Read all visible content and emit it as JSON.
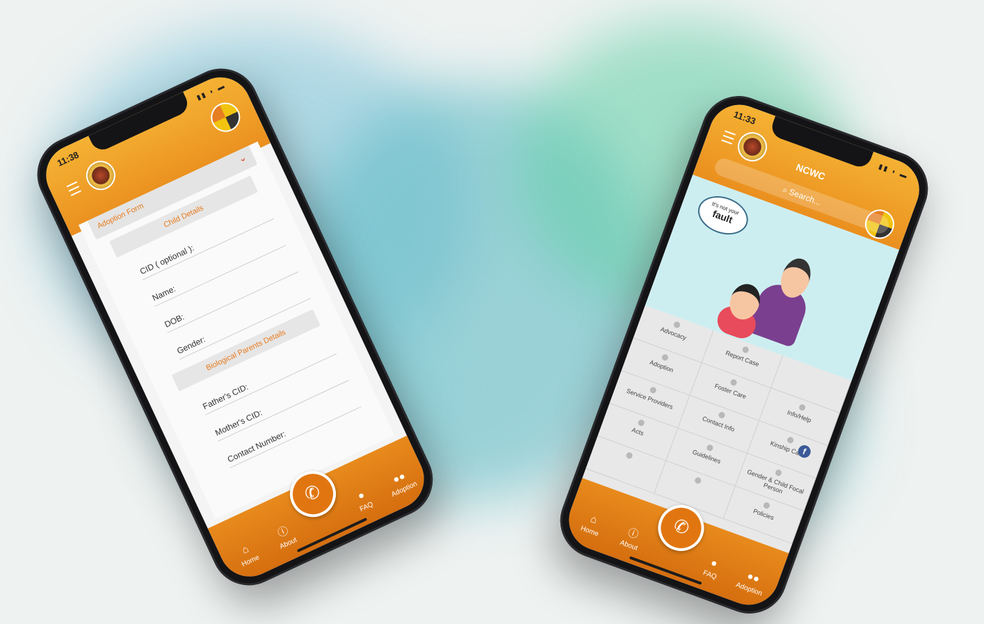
{
  "colors": {
    "accent": "#ea8f1f",
    "accent_dark": "#d56e0f",
    "label_orange": "#e77a1d",
    "background_teal": "#5fc2c6"
  },
  "left_phone": {
    "status_time": "11:38",
    "form_header": "Adoption Form",
    "sections": [
      "Child Details",
      "Biological Parents Details"
    ],
    "fields": [
      "CID ( optional ):",
      "Name:",
      "DOB:",
      "Gender:",
      "Father's CID:",
      "Mother's CID:",
      "Contact Number:"
    ]
  },
  "right_phone": {
    "status_time": "11:33",
    "app_title": "NCWC",
    "search_placeholder": "Search...",
    "hero_bubble_small": "It's not your",
    "hero_bubble_big": "fault",
    "grid_items": [
      "Advocacy",
      "Report Case",
      "",
      "Adoption",
      "Foster Care",
      "Info/Help",
      "Service Providers",
      "Contact Info",
      "Kinship Care",
      "Acts",
      "Guidelines",
      "Gender & Child Focal Person",
      "",
      "",
      "Policies"
    ]
  },
  "tabbar": {
    "tabs": [
      {
        "label": "Home",
        "icon": "home-icon"
      },
      {
        "label": "About",
        "icon": "info-icon"
      },
      {
        "label": "FAQ",
        "icon": "faq-icon"
      },
      {
        "label": "Adoption",
        "icon": "people-icon"
      }
    ]
  }
}
